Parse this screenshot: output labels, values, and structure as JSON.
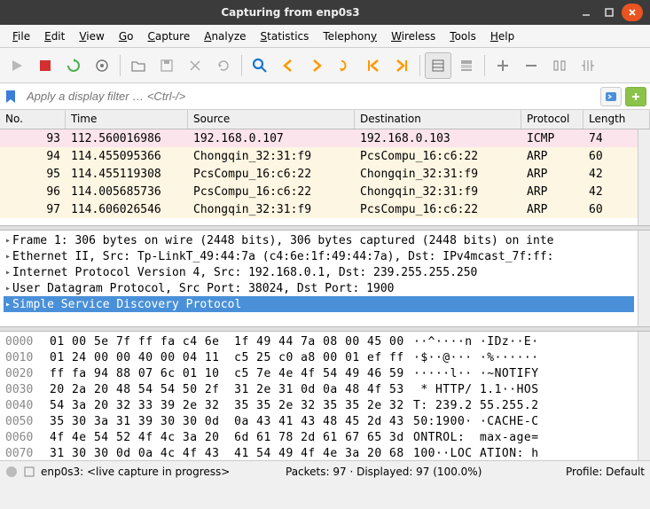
{
  "window": {
    "title": "Capturing from enp0s3"
  },
  "menu": {
    "file": "File",
    "edit": "Edit",
    "view": "View",
    "go": "Go",
    "capture": "Capture",
    "analyze": "Analyze",
    "statistics": "Statistics",
    "telephony": "Telephony",
    "wireless": "Wireless",
    "tools": "Tools",
    "help": "Help"
  },
  "filter": {
    "placeholder": "Apply a display filter … <Ctrl-/>",
    "value": ""
  },
  "packet_list": {
    "headers": {
      "no": "No.",
      "time": "Time",
      "src": "Source",
      "dst": "Destination",
      "proto": "Protocol",
      "len": "Length"
    },
    "rows": [
      {
        "no": "93",
        "time": "112.560016986",
        "src": "192.168.0.107",
        "dst": "192.168.0.103",
        "proto": "ICMP",
        "len": "74",
        "style": "pink"
      },
      {
        "no": "94",
        "time": "114.455095366",
        "src": "Chongqin_32:31:f9",
        "dst": "PcsCompu_16:c6:22",
        "proto": "ARP",
        "len": "60",
        "style": "cream"
      },
      {
        "no": "95",
        "time": "114.455119308",
        "src": "PcsCompu_16:c6:22",
        "dst": "Chongqin_32:31:f9",
        "proto": "ARP",
        "len": "42",
        "style": "cream"
      },
      {
        "no": "96",
        "time": "114.005685736",
        "src": "PcsCompu_16:c6:22",
        "dst": "Chongqin_32:31:f9",
        "proto": "ARP",
        "len": "42",
        "style": "cream"
      },
      {
        "no": "97",
        "time": "114.606026546",
        "src": "Chongqin_32:31:f9",
        "dst": "PcsCompu_16:c6:22",
        "proto": "ARP",
        "len": "60",
        "style": "cream"
      }
    ]
  },
  "details": {
    "lines": [
      {
        "text": "Frame 1: 306 bytes on wire (2448 bits), 306 bytes captured (2448 bits) on inte",
        "sel": false
      },
      {
        "text": "Ethernet II, Src: Tp-LinkT_49:44:7a (c4:6e:1f:49:44:7a), Dst: IPv4mcast_7f:ff:",
        "sel": false
      },
      {
        "text": "Internet Protocol Version 4, Src: 192.168.0.1, Dst: 239.255.255.250",
        "sel": false
      },
      {
        "text": "User Datagram Protocol, Src Port: 38024, Dst Port: 1900",
        "sel": false
      },
      {
        "text": "Simple Service Discovery Protocol",
        "sel": true
      }
    ]
  },
  "hex": {
    "rows": [
      {
        "off": "0000",
        "bytes": "01 00 5e 7f ff fa c4 6e  1f 49 44 7a 08 00 45 00",
        "ascii": "··^····n ·IDz··E·"
      },
      {
        "off": "0010",
        "bytes": "01 24 00 00 40 00 04 11  c5 25 c0 a8 00 01 ef ff",
        "ascii": "·$··@··· ·%······"
      },
      {
        "off": "0020",
        "bytes": "ff fa 94 88 07 6c 01 10  c5 7e 4e 4f 54 49 46 59",
        "ascii": "·····l·· ·~NOTIFY"
      },
      {
        "off": "0030",
        "bytes": "20 2a 20 48 54 54 50 2f  31 2e 31 0d 0a 48 4f 53",
        "ascii": " * HTTP/ 1.1··HOS"
      },
      {
        "off": "0040",
        "bytes": "54 3a 20 32 33 39 2e 32  35 35 2e 32 35 35 2e 32",
        "ascii": "T: 239.2 55.255.2"
      },
      {
        "off": "0050",
        "bytes": "35 30 3a 31 39 30 30 0d  0a 43 41 43 48 45 2d 43",
        "ascii": "50:1900· ·CACHE-C"
      },
      {
        "off": "0060",
        "bytes": "4f 4e 54 52 4f 4c 3a 20  6d 61 78 2d 61 67 65 3d",
        "ascii": "ONTROL:  max-age="
      },
      {
        "off": "0070",
        "bytes": "31 30 30 0d 0a 4c 4f 43  41 54 49 4f 4e 3a 20 68",
        "ascii": "100··LOC ATION: h"
      }
    ]
  },
  "status": {
    "iface": "enp0s3: <live capture in progress>",
    "packets": "Packets: 97 · Displayed: 97 (100.0%)",
    "profile": "Profile: Default"
  }
}
